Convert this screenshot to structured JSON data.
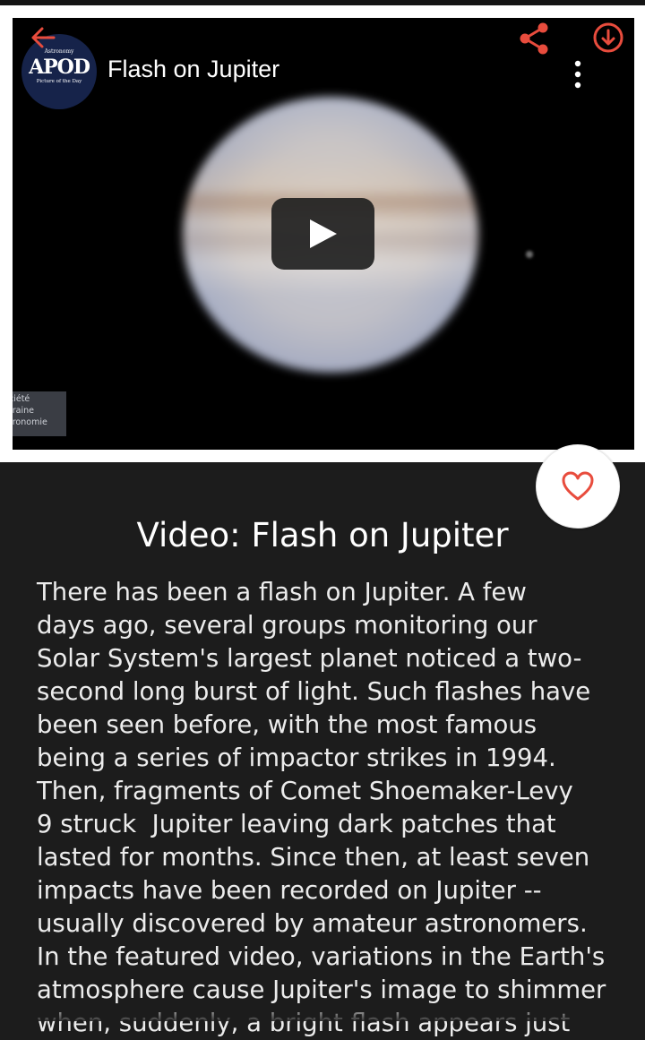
{
  "video": {
    "title": "Flash on Jupiter",
    "watermark_lines": [
      "ciété",
      "rraine",
      "tronomie"
    ]
  },
  "logo": {
    "small_top": "Astronomy",
    "main": "APOD",
    "sub": "Picture of the Day"
  },
  "icons": {
    "back": "arrow-back-icon",
    "share": "share-icon",
    "download": "download-icon",
    "more": "more-vertical-icon",
    "play": "play-icon",
    "favorite": "heart-icon"
  },
  "colors": {
    "accent": "#e84c3d",
    "background": "#1c1c1c",
    "text": "#ececec"
  },
  "article": {
    "title": "Video: Flash on Jupiter",
    "lines": [
      "There has been a flash on Jupiter. A few",
      "days ago, several groups monitoring our",
      "Solar System's largest planet noticed a two-",
      "second long burst of light. Such flashes have",
      "been seen before, with the most famous",
      "being a series of impactor strikes in 1994.",
      "Then, fragments of Comet Shoemaker-Levy",
      "9 struck  Jupiter leaving dark patches that",
      "lasted for months. Since then, at least seven",
      "impacts have been recorded on Jupiter --",
      "usually discovered by amateur astronomers.",
      "In the featured video, variations in the Earth's",
      "atmosphere cause Jupiter's image to shimmer",
      "when, suddenly, a bright flash appears just"
    ]
  }
}
